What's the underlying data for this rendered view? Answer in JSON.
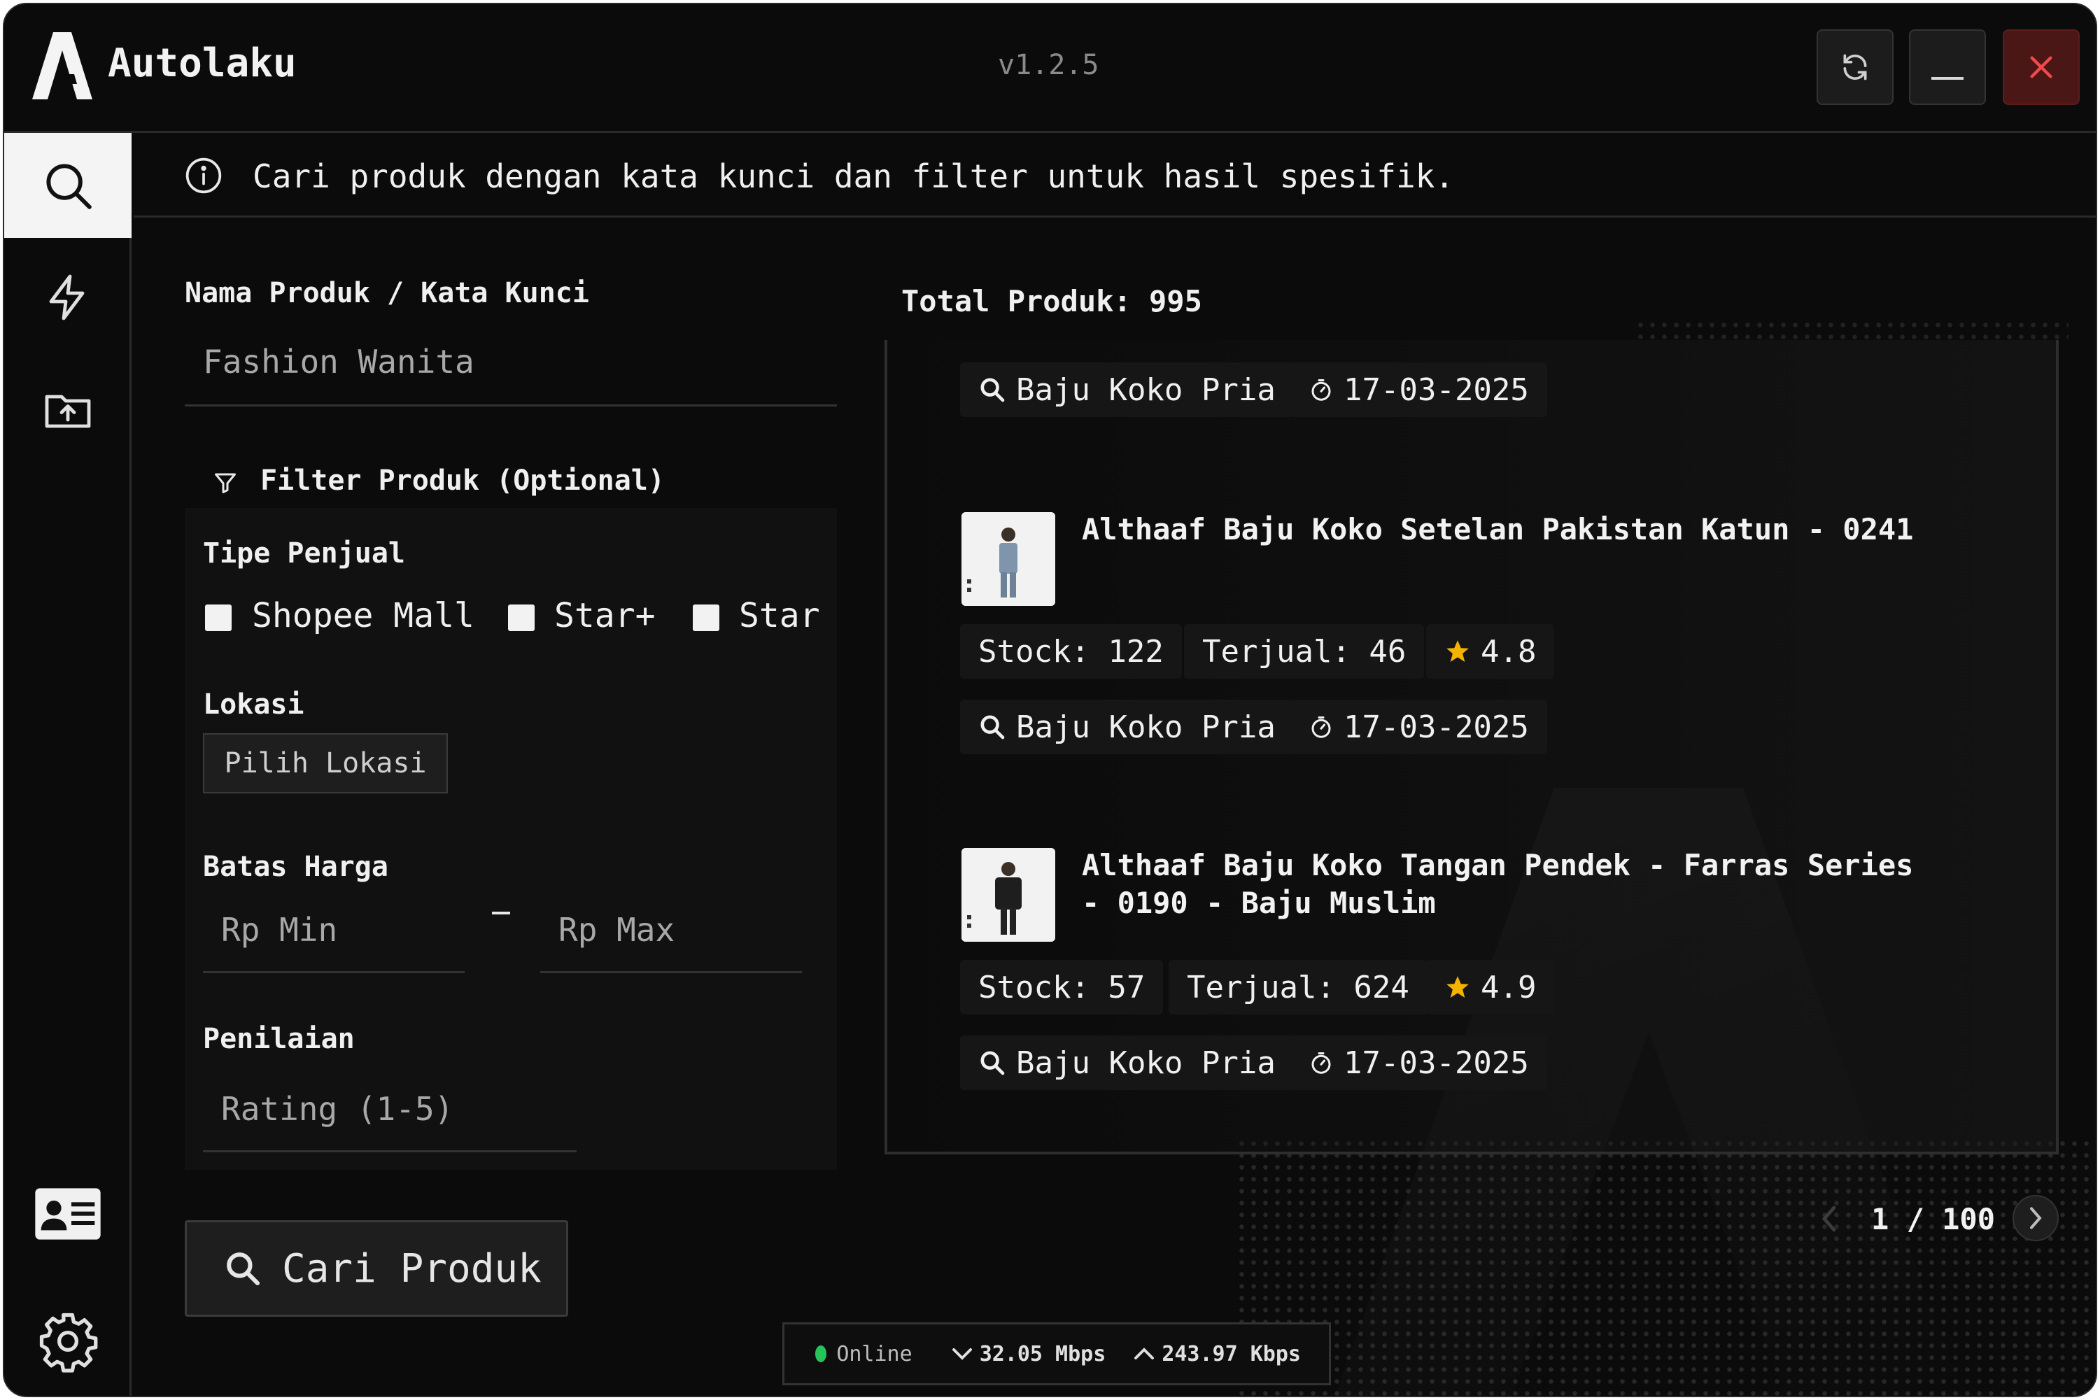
{
  "window": {
    "title": "Autolaku",
    "version": "v1.2.5"
  },
  "colors": {
    "accent": "#f4f4f4",
    "background": "#0b0b0b",
    "close": "#4a1616",
    "star": "#f5b301",
    "online": "#27c25a"
  },
  "sidebar": {
    "items": [
      {
        "icon": "search-icon",
        "active": true
      },
      {
        "icon": "lightning-icon",
        "active": false
      },
      {
        "icon": "folder-upload-icon",
        "active": false
      },
      {
        "icon": "id-card-icon",
        "active": false
      },
      {
        "icon": "gear-icon",
        "active": false
      }
    ]
  },
  "info": {
    "text": "Cari produk dengan kata kunci dan filter untuk hasil spesifik."
  },
  "form": {
    "keyword_label": "Nama Produk / Kata Kunci",
    "keyword_value": "Fashion Wanita",
    "filter_title": "Filter Produk (Optional)",
    "seller_type_label": "Tipe Penjual",
    "seller_types": [
      "Shopee Mall",
      "Star+",
      "Star"
    ],
    "location_label": "Lokasi",
    "location_button": "Pilih Lokasi",
    "price_label": "Batas Harga",
    "price_min_placeholder": "Rp Min",
    "price_max_placeholder": "Rp Max",
    "rating_label": "Penilaian",
    "rating_placeholder": "Rating (1-5)",
    "search_button": "Cari Produk"
  },
  "results": {
    "total_label": "Total Produk: 995",
    "first_meta": {
      "keyword": "Baju Koko Pria",
      "date": "17-03-2025"
    },
    "products": [
      {
        "title": "Althaaf Baju Koko Setelan Pakistan Katun - 0241",
        "stock": "Stock: 122",
        "sold": "Terjual: 46",
        "rating": "4.8",
        "keyword": "Baju Koko Pria",
        "date": "17-03-2025"
      },
      {
        "title": "Althaaf Baju Koko Tangan Pendek - Farras Series - 0190 - Baju Muslim",
        "stock": "Stock: 57",
        "sold": "Terjual: 624",
        "rating": "4.9",
        "keyword": "Baju Koko Pria",
        "date": "17-03-2025"
      }
    ]
  },
  "pagination": {
    "text": "1 / 100"
  },
  "status": {
    "connection": "Online",
    "download": "32.05 Mbps",
    "upload": "243.97 Kbps"
  }
}
